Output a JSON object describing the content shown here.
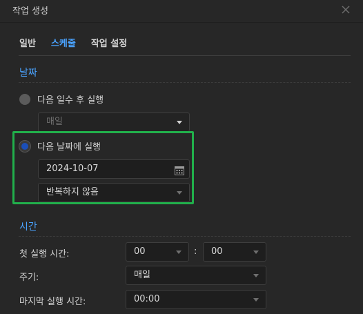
{
  "dialog": {
    "title": "작업 생성"
  },
  "tabs": [
    {
      "label": "일반"
    },
    {
      "label": "스케줄"
    },
    {
      "label": "작업 설정"
    }
  ],
  "date_section": {
    "title": "날짜",
    "option_days": {
      "label": "다음 일수 후 실행",
      "select_value": "매일"
    },
    "option_date": {
      "label": "다음 날짜에 실행",
      "date_value": "2024-10-07",
      "repeat_value": "반복하지 않음"
    }
  },
  "time_section": {
    "title": "시간",
    "first_run_label": "첫 실행 시간:",
    "hour_value": "00",
    "colon": ":",
    "minute_value": "00",
    "cycle_label": "주기:",
    "cycle_value": "매일",
    "last_run_label": "마지막 실행 시간:",
    "last_run_value": "00:00"
  },
  "colors": {
    "accent": "#4aa3ff",
    "highlight_border": "#21b04b",
    "background": "#272727"
  }
}
